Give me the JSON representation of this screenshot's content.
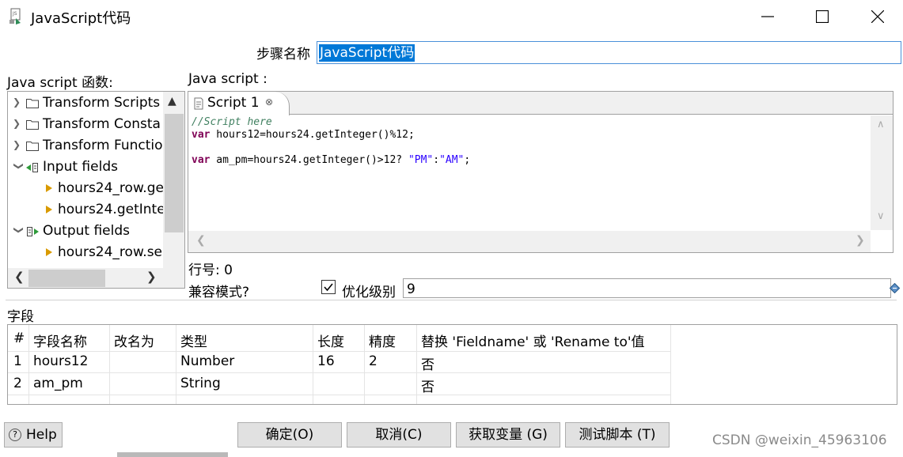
{
  "window": {
    "title": "JavaScript代码",
    "app_icon": "kettle-script-icon",
    "controls": [
      "minimize",
      "maximize",
      "close"
    ]
  },
  "step_name": {
    "label": "步骤名称",
    "value": "JavaScript代码"
  },
  "functions_panel": {
    "label": "Java script 函数:",
    "items": [
      {
        "label": "Transform Scripts",
        "icon": "folder-icon",
        "expanded": false
      },
      {
        "label": "Transform Consta",
        "icon": "folder-icon",
        "expanded": false
      },
      {
        "label": "Transform Functio",
        "icon": "folder-icon",
        "expanded": false
      },
      {
        "label": "Input fields",
        "icon": "input-fields-icon",
        "expanded": true
      },
      {
        "label": "hours24_row.ge",
        "icon": "field-arrow-icon",
        "child": true
      },
      {
        "label": "hours24.getInte",
        "icon": "field-arrow-icon",
        "child": true
      },
      {
        "label": "Output fields",
        "icon": "output-fields-icon",
        "expanded": true
      },
      {
        "label": "hours24_row.se",
        "icon": "field-arrow-icon",
        "child": true
      }
    ]
  },
  "script_panel": {
    "label": "Java script :",
    "tab_label": "Script 1",
    "code_lines": [
      {
        "comment": "//Script here"
      },
      {
        "keyword": "var",
        "text": " hours12=hours24.getInteger()%12;"
      },
      {
        "text": ""
      },
      {
        "keyword": "var",
        "text": " am_pm=hours24.getInteger()>12? ",
        "str1": "\"PM\"",
        "mid": ":",
        "str2": "\"AM\"",
        "end": ";"
      }
    ]
  },
  "line_number": "行号: 0",
  "compat_mode_label": "兼容模式?",
  "optimization": {
    "checked": true,
    "label": "优化级别",
    "value": "9"
  },
  "fields_section": {
    "label": "字段",
    "columns": [
      "#",
      "字段名称",
      "改名为",
      "类型",
      "长度",
      "精度",
      "替换 'Fieldname' 或 'Rename to'值"
    ],
    "rows": [
      [
        "1",
        "hours12",
        "",
        "Number",
        "16",
        "2",
        "否"
      ],
      [
        "2",
        "am_pm",
        "",
        "String",
        "",
        "",
        "否"
      ]
    ]
  },
  "buttons": {
    "help": "Help",
    "ok": "确定(O)",
    "cancel": "取消(C)",
    "get_vars": "获取变量 (G)",
    "test_script": "测试脚本 (T)"
  },
  "watermark": "CSDN @weixin_45963106"
}
